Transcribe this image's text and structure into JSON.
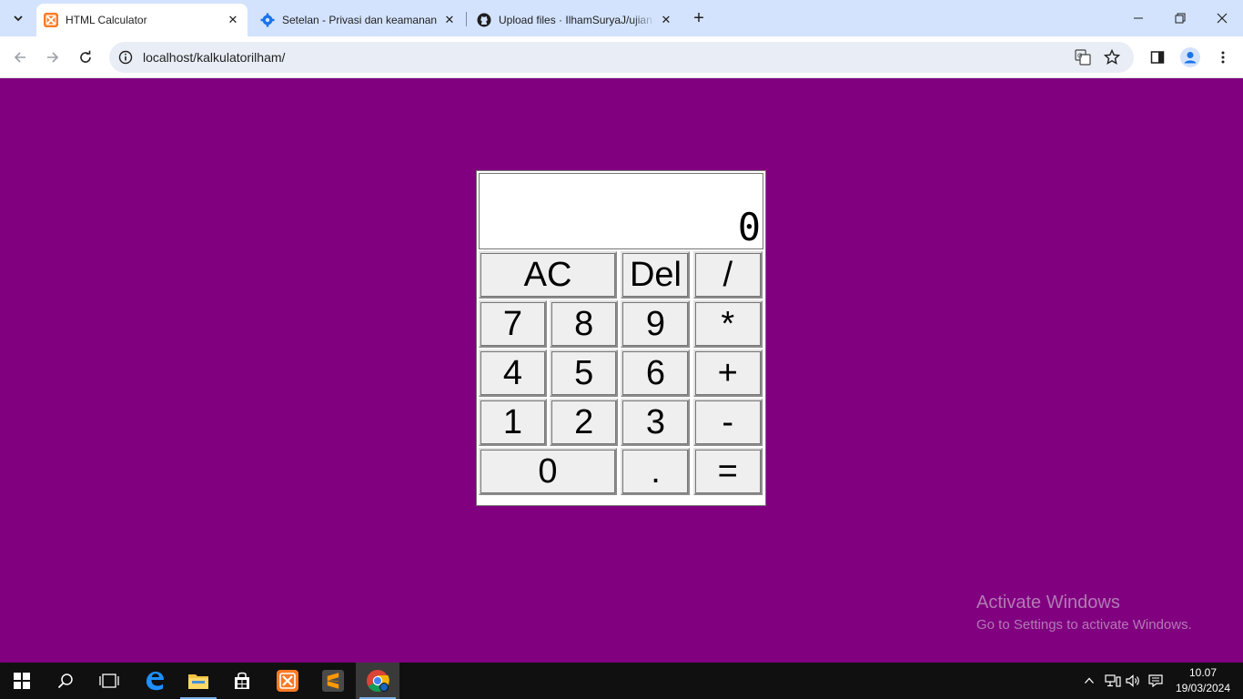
{
  "browser": {
    "tabs": [
      {
        "title": "HTML Calculator",
        "favicon": "xampp-icon",
        "active": true
      },
      {
        "title": "Setelan - Privasi dan keamanan",
        "favicon": "gear-icon",
        "active": false
      },
      {
        "title": "Upload files · IlhamSuryaJ/ujian",
        "favicon": "github-icon",
        "active": false
      }
    ],
    "url": "localhost/kalkulatorilham/",
    "colors": {
      "tabstrip": "#d3e3fd",
      "omnibox": "#e9eef6"
    }
  },
  "page": {
    "background": "#800080",
    "display": "0",
    "keys": {
      "ac": "AC",
      "del": "Del",
      "div": "/",
      "k7": "7",
      "k8": "8",
      "k9": "9",
      "mul": "*",
      "k4": "4",
      "k5": "5",
      "k6": "6",
      "add": "+",
      "k1": "1",
      "k2": "2",
      "k3": "3",
      "sub": "-",
      "k0": "0",
      "dot": ".",
      "eq": "="
    }
  },
  "watermark": {
    "title": "Activate Windows",
    "subtitle": "Go to Settings to activate Windows."
  },
  "taskbar": {
    "apps": [
      "start-icon",
      "search-icon",
      "task-view-icon",
      "edge-icon",
      "file-explorer-icon",
      "store-icon",
      "xampp-icon",
      "sublime-text-icon",
      "chrome-icon"
    ],
    "time": "10.07",
    "date": "19/03/2024"
  }
}
